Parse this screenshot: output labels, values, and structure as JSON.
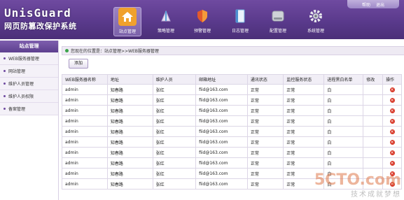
{
  "brand": {
    "title_en": "UnisGuard",
    "title_cn": "网页防篡改保护系统"
  },
  "top_links": {
    "help": "帮助",
    "logout": "退出"
  },
  "nav": [
    {
      "label": "站点管理",
      "icon": "home-icon",
      "active": true
    },
    {
      "label": "策略管理",
      "icon": "strategy-icon",
      "active": false
    },
    {
      "label": "预警管理",
      "icon": "shield-icon",
      "active": false
    },
    {
      "label": "日志管理",
      "icon": "log-icon",
      "active": false
    },
    {
      "label": "配置管理",
      "icon": "config-icon",
      "active": false
    },
    {
      "label": "系统管理",
      "icon": "gear-icon",
      "active": false
    }
  ],
  "sidebar": {
    "title": "站点管理",
    "items": [
      {
        "label": "WEB服务器管理"
      },
      {
        "label": "网站管理"
      },
      {
        "label": "维护人员管理"
      },
      {
        "label": "维护人员权限"
      },
      {
        "label": "备案管理"
      }
    ]
  },
  "breadcrumb": {
    "text": "您现在的位置是：站点管理>>WEB服务器管理"
  },
  "toolbar": {
    "add_label": "添加"
  },
  "table": {
    "headers": [
      "WEB服务器名称",
      "地址",
      "维护人员",
      "邮箱地址",
      "通讯状态",
      "监控服务状态",
      "进程黑白名单",
      "修改",
      "操作"
    ],
    "rows": [
      [
        "admin",
        "知春路",
        "张红",
        "fiid@163.com",
        "正常",
        "正常",
        "白",
        "",
        ""
      ],
      [
        "admin",
        "知春路",
        "张红",
        "fiid@163.com",
        "正常",
        "正常",
        "白",
        "",
        ""
      ],
      [
        "admin",
        "知春路",
        "张红",
        "fiid@163.com",
        "正常",
        "正常",
        "白",
        "",
        ""
      ],
      [
        "admin",
        "知春路",
        "张红",
        "fiid@163.com",
        "正常",
        "正常",
        "白",
        "",
        ""
      ],
      [
        "admin",
        "知春路",
        "张红",
        "fiid@163.com",
        "正常",
        "正常",
        "白",
        "",
        ""
      ],
      [
        "admin",
        "知春路",
        "张红",
        "fiid@163.com",
        "正常",
        "正常",
        "白",
        "",
        ""
      ],
      [
        "admin",
        "知春路",
        "张红",
        "fiid@163.com",
        "正常",
        "正常",
        "白",
        "",
        ""
      ],
      [
        "admin",
        "知春路",
        "张红",
        "fiid@163.com",
        "正常",
        "正常",
        "白",
        "",
        ""
      ],
      [
        "admin",
        "知春路",
        "张红",
        "fiid@163.com",
        "正常",
        "正常",
        "白",
        "",
        ""
      ],
      [
        "admin",
        "知春路",
        "张红",
        "fiid@163.com",
        "正常",
        "正常",
        "白",
        "",
        ""
      ]
    ]
  },
  "watermark": {
    "logo": "5CTO.com",
    "sub": "技术成就梦想"
  },
  "colors": {
    "header": "#5a3a8c",
    "accent": "#f0a12d",
    "delete": "#d83a2a"
  }
}
